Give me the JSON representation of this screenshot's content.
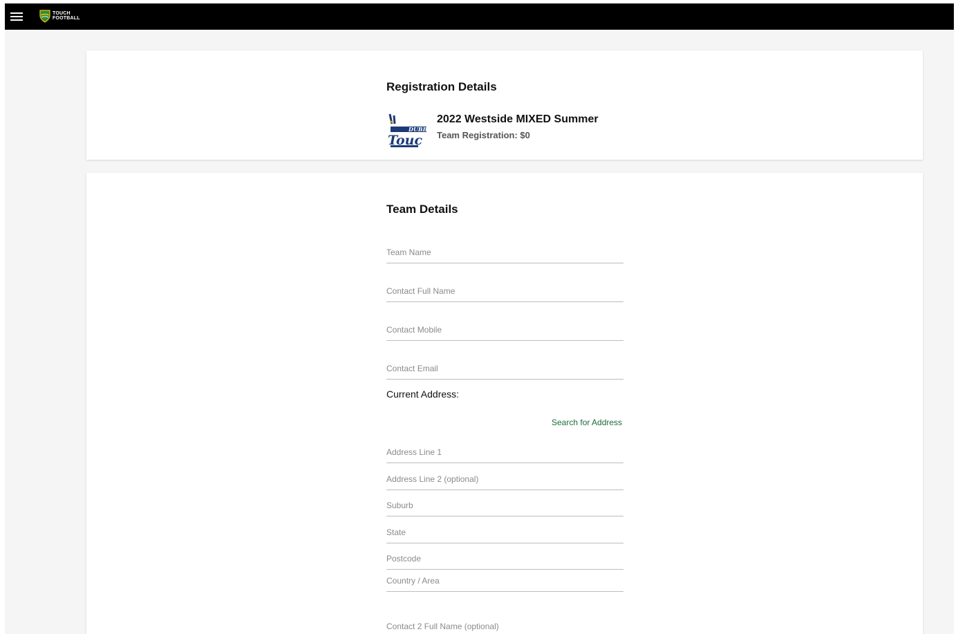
{
  "header": {
    "logo_line1": "TOUCH",
    "logo_line2": "FOOTBALL",
    "logo_colors": {
      "shield_green": "#2e8b3d",
      "shield_gold": "#f2c200"
    }
  },
  "registration": {
    "title": "Registration Details",
    "event_name": "2022 Westside MIXED Summer",
    "event_sub": "Team Registration: $0",
    "event_logo_text": "DUBBO Touch"
  },
  "team": {
    "title": "Team Details",
    "team_name_placeholder": "Team Name",
    "contact_name_placeholder": "Contact Full Name",
    "contact_mobile_placeholder": "Contact Mobile",
    "contact_email_placeholder": "Contact Email",
    "address_label": "Current Address:",
    "search_address_label": "Search for Address",
    "address1_placeholder": "Address Line 1",
    "address2_placeholder": "Address Line 2 (optional)",
    "suburb_placeholder": "Suburb",
    "state_placeholder": "State",
    "postcode_placeholder": "Postcode",
    "country_placeholder": "Country / Area",
    "contact2_placeholder": "Contact 2 Full Name (optional)"
  },
  "theme": {
    "accent_green": "#1b6b3a",
    "topbar": "#000000"
  }
}
